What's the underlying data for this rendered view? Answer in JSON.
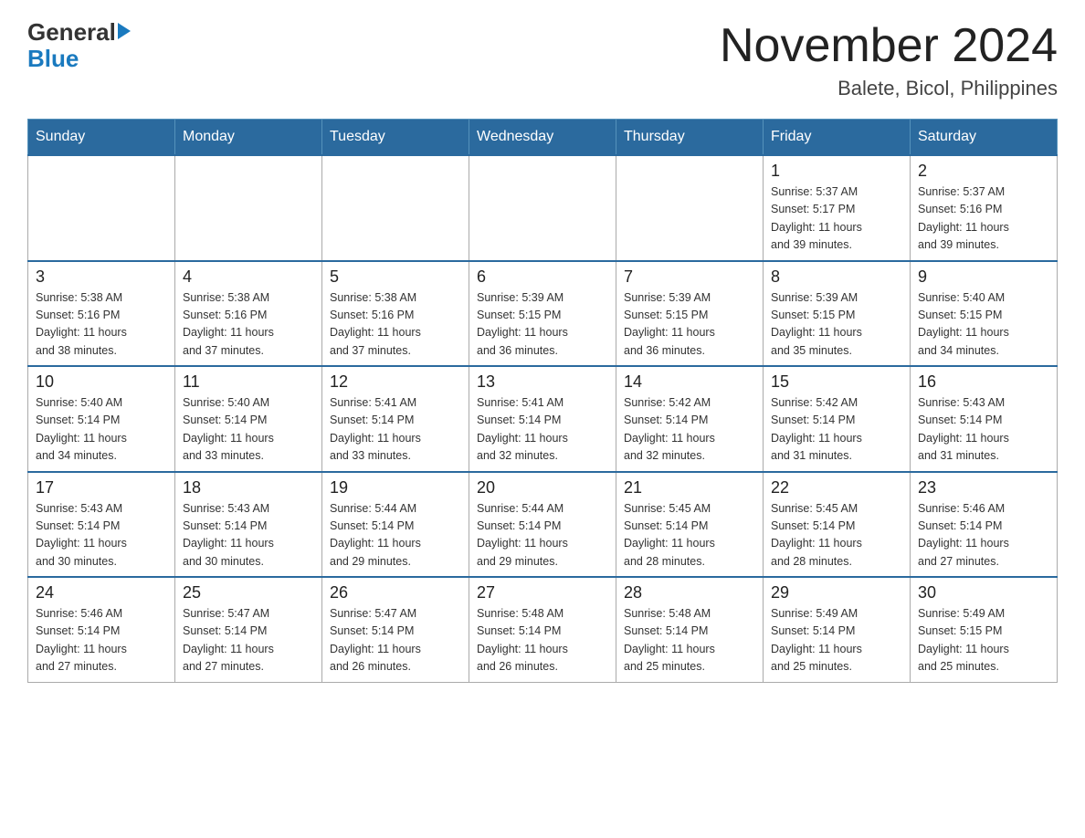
{
  "header": {
    "logo_general": "General",
    "logo_blue": "Blue",
    "month_title": "November 2024",
    "location": "Balete, Bicol, Philippines"
  },
  "weekdays": [
    "Sunday",
    "Monday",
    "Tuesday",
    "Wednesday",
    "Thursday",
    "Friday",
    "Saturday"
  ],
  "weeks": [
    [
      {
        "day": "",
        "info": ""
      },
      {
        "day": "",
        "info": ""
      },
      {
        "day": "",
        "info": ""
      },
      {
        "day": "",
        "info": ""
      },
      {
        "day": "",
        "info": ""
      },
      {
        "day": "1",
        "info": "Sunrise: 5:37 AM\nSunset: 5:17 PM\nDaylight: 11 hours\nand 39 minutes."
      },
      {
        "day": "2",
        "info": "Sunrise: 5:37 AM\nSunset: 5:16 PM\nDaylight: 11 hours\nand 39 minutes."
      }
    ],
    [
      {
        "day": "3",
        "info": "Sunrise: 5:38 AM\nSunset: 5:16 PM\nDaylight: 11 hours\nand 38 minutes."
      },
      {
        "day": "4",
        "info": "Sunrise: 5:38 AM\nSunset: 5:16 PM\nDaylight: 11 hours\nand 37 minutes."
      },
      {
        "day": "5",
        "info": "Sunrise: 5:38 AM\nSunset: 5:16 PM\nDaylight: 11 hours\nand 37 minutes."
      },
      {
        "day": "6",
        "info": "Sunrise: 5:39 AM\nSunset: 5:15 PM\nDaylight: 11 hours\nand 36 minutes."
      },
      {
        "day": "7",
        "info": "Sunrise: 5:39 AM\nSunset: 5:15 PM\nDaylight: 11 hours\nand 36 minutes."
      },
      {
        "day": "8",
        "info": "Sunrise: 5:39 AM\nSunset: 5:15 PM\nDaylight: 11 hours\nand 35 minutes."
      },
      {
        "day": "9",
        "info": "Sunrise: 5:40 AM\nSunset: 5:15 PM\nDaylight: 11 hours\nand 34 minutes."
      }
    ],
    [
      {
        "day": "10",
        "info": "Sunrise: 5:40 AM\nSunset: 5:14 PM\nDaylight: 11 hours\nand 34 minutes."
      },
      {
        "day": "11",
        "info": "Sunrise: 5:40 AM\nSunset: 5:14 PM\nDaylight: 11 hours\nand 33 minutes."
      },
      {
        "day": "12",
        "info": "Sunrise: 5:41 AM\nSunset: 5:14 PM\nDaylight: 11 hours\nand 33 minutes."
      },
      {
        "day": "13",
        "info": "Sunrise: 5:41 AM\nSunset: 5:14 PM\nDaylight: 11 hours\nand 32 minutes."
      },
      {
        "day": "14",
        "info": "Sunrise: 5:42 AM\nSunset: 5:14 PM\nDaylight: 11 hours\nand 32 minutes."
      },
      {
        "day": "15",
        "info": "Sunrise: 5:42 AM\nSunset: 5:14 PM\nDaylight: 11 hours\nand 31 minutes."
      },
      {
        "day": "16",
        "info": "Sunrise: 5:43 AM\nSunset: 5:14 PM\nDaylight: 11 hours\nand 31 minutes."
      }
    ],
    [
      {
        "day": "17",
        "info": "Sunrise: 5:43 AM\nSunset: 5:14 PM\nDaylight: 11 hours\nand 30 minutes."
      },
      {
        "day": "18",
        "info": "Sunrise: 5:43 AM\nSunset: 5:14 PM\nDaylight: 11 hours\nand 30 minutes."
      },
      {
        "day": "19",
        "info": "Sunrise: 5:44 AM\nSunset: 5:14 PM\nDaylight: 11 hours\nand 29 minutes."
      },
      {
        "day": "20",
        "info": "Sunrise: 5:44 AM\nSunset: 5:14 PM\nDaylight: 11 hours\nand 29 minutes."
      },
      {
        "day": "21",
        "info": "Sunrise: 5:45 AM\nSunset: 5:14 PM\nDaylight: 11 hours\nand 28 minutes."
      },
      {
        "day": "22",
        "info": "Sunrise: 5:45 AM\nSunset: 5:14 PM\nDaylight: 11 hours\nand 28 minutes."
      },
      {
        "day": "23",
        "info": "Sunrise: 5:46 AM\nSunset: 5:14 PM\nDaylight: 11 hours\nand 27 minutes."
      }
    ],
    [
      {
        "day": "24",
        "info": "Sunrise: 5:46 AM\nSunset: 5:14 PM\nDaylight: 11 hours\nand 27 minutes."
      },
      {
        "day": "25",
        "info": "Sunrise: 5:47 AM\nSunset: 5:14 PM\nDaylight: 11 hours\nand 27 minutes."
      },
      {
        "day": "26",
        "info": "Sunrise: 5:47 AM\nSunset: 5:14 PM\nDaylight: 11 hours\nand 26 minutes."
      },
      {
        "day": "27",
        "info": "Sunrise: 5:48 AM\nSunset: 5:14 PM\nDaylight: 11 hours\nand 26 minutes."
      },
      {
        "day": "28",
        "info": "Sunrise: 5:48 AM\nSunset: 5:14 PM\nDaylight: 11 hours\nand 25 minutes."
      },
      {
        "day": "29",
        "info": "Sunrise: 5:49 AM\nSunset: 5:14 PM\nDaylight: 11 hours\nand 25 minutes."
      },
      {
        "day": "30",
        "info": "Sunrise: 5:49 AM\nSunset: 5:15 PM\nDaylight: 11 hours\nand 25 minutes."
      }
    ]
  ]
}
